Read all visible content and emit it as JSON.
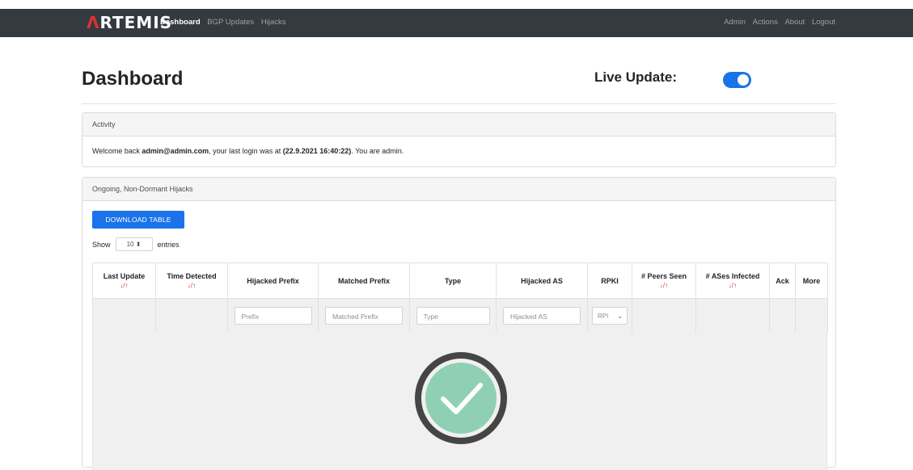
{
  "nav": {
    "brand_accent": "Λ",
    "brand_rest": "RTEMIS",
    "left_links": [
      {
        "label": "Dashboard",
        "active": true
      },
      {
        "label": "BGP Updates",
        "active": false
      },
      {
        "label": "Hijacks",
        "active": false
      }
    ],
    "right_links": [
      "Admin",
      "Actions",
      "About",
      "Logout"
    ]
  },
  "header": {
    "title": "Dashboard",
    "live_update_label": "Live Update:",
    "live_update_on": true
  },
  "activity": {
    "header": "Activity",
    "welcome_prefix": "Welcome back ",
    "user": "admin@admin.com",
    "mid_text": ", your last login was at ",
    "last_login": "(22.9.2021 16:40:22)",
    "suffix": ". You are admin."
  },
  "hijacks": {
    "header": "Ongoing, Non-Dormant Hijacks",
    "download_label": "DOWNLOAD TABLE",
    "show_label": "Show",
    "entries_value": "10",
    "entries_label": "entries",
    "sort_down": "↓",
    "sort_sep": "/",
    "sort_up": "↑",
    "columns": {
      "last_update": "Last Update",
      "time_detected": "Time Detected",
      "hijacked_prefix": "Hijacked Prefix",
      "matched_prefix": "Matched Prefix",
      "type": "Type",
      "hijacked_as": "Hijacked AS",
      "rpki": "RPKI",
      "peers_seen": "# Peers Seen",
      "ases_infected": "# ASes Infected",
      "ack": "Ack",
      "more": "More"
    },
    "filters": {
      "prefix": "Prefix",
      "matched_prefix": "Matched Prefix",
      "type": "Type",
      "hijacked_as": "Hijacked AS",
      "rpki": "RPI"
    }
  },
  "colors": {
    "navbar": "#343a40",
    "accent_blue": "#1a73e8",
    "brand_red": "#e03131",
    "check_green": "#8fd0b5",
    "check_ring": "#454545"
  }
}
